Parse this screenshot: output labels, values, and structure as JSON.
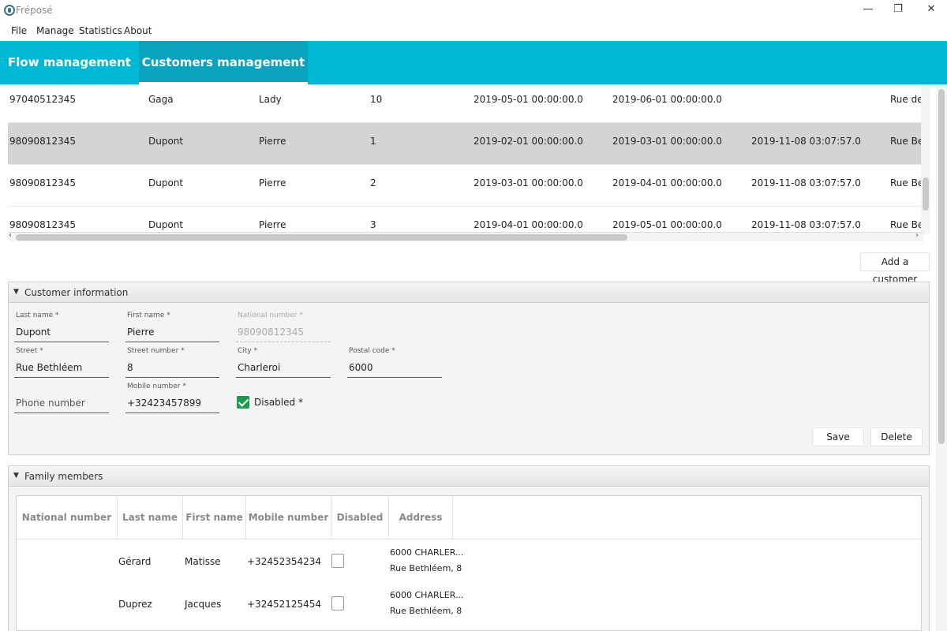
{
  "window": {
    "title": "Fréposé",
    "minimize": "—",
    "restore": "❐",
    "close": "✕"
  },
  "menu": [
    "File",
    "Manage",
    "Statistics",
    "About"
  ],
  "tabs": [
    {
      "label": "Flow management",
      "active": false
    },
    {
      "label": "Customers management",
      "active": true
    }
  ],
  "top_table": {
    "rows": [
      {
        "national": "97040512345",
        "last": "Gaga",
        "first": "Lady",
        "num": "10",
        "start": "2019-05-01 00:00:00.0",
        "end": "2019-06-01 00:00:00.0",
        "created": "",
        "address": "Rue de l",
        "selected": false
      },
      {
        "national": "98090812345",
        "last": "Dupont",
        "first": "Pierre",
        "num": "1",
        "start": "2019-02-01 00:00:00.0",
        "end": "2019-03-01 00:00:00.0",
        "created": "2019-11-08 03:07:57.0",
        "address": "Rue Beth",
        "selected": true
      },
      {
        "national": "98090812345",
        "last": "Dupont",
        "first": "Pierre",
        "num": "2",
        "start": "2019-03-01 00:00:00.0",
        "end": "2019-04-01 00:00:00.0",
        "created": "2019-11-08 03:07:57.0",
        "address": "Rue Beth",
        "selected": false
      },
      {
        "national": "98090812345",
        "last": "Dupont",
        "first": "Pierre",
        "num": "3",
        "start": "2019-04-01 00:00:00.0",
        "end": "2019-05-01 00:00:00.0",
        "created": "2019-11-08 03:07:57.0",
        "address": "Rue Beth",
        "selected": false
      }
    ]
  },
  "add_customer_label": "Add a customer",
  "customer_info": {
    "title": "Customer information",
    "last_name": {
      "label": "Last name *",
      "value": "Dupont"
    },
    "first_name": {
      "label": "First name *",
      "value": "Pierre"
    },
    "national_number": {
      "label": "National number *",
      "value": "98090812345"
    },
    "street": {
      "label": "Street *",
      "value": "Rue Bethléem"
    },
    "street_number": {
      "label": "Street number *",
      "value": "8"
    },
    "city": {
      "label": "City *",
      "value": "Charleroi"
    },
    "postal_code": {
      "label": "Postal code *",
      "value": "6000"
    },
    "phone": {
      "placeholder": "Phone number"
    },
    "mobile": {
      "label": "Mobile number *",
      "value": "+32423457899"
    },
    "disabled": {
      "label": "Disabled *",
      "checked": true
    },
    "save_label": "Save",
    "delete_label": "Delete"
  },
  "family": {
    "title": "Family members",
    "columns": [
      "National number",
      "Last name",
      "First name",
      "Mobile number",
      "Disabled",
      "Address"
    ],
    "rows": [
      {
        "national": "",
        "last": "Gérard",
        "first": "Matisse",
        "mobile": "+32452354234",
        "disabled": false,
        "address1": "6000 CHARLER...",
        "address2": "Rue Bethléem, 8"
      },
      {
        "national": "",
        "last": "Duprez",
        "first": "Jacques",
        "mobile": "+32452125454",
        "disabled": false,
        "address1": "6000 CHARLER...",
        "address2": "Rue Bethléem, 8"
      }
    ]
  },
  "colors": {
    "tab_bar": "#00b8d4",
    "selected_row": "#d4d4d4",
    "checkbox_checked": "#1e9a4e"
  }
}
